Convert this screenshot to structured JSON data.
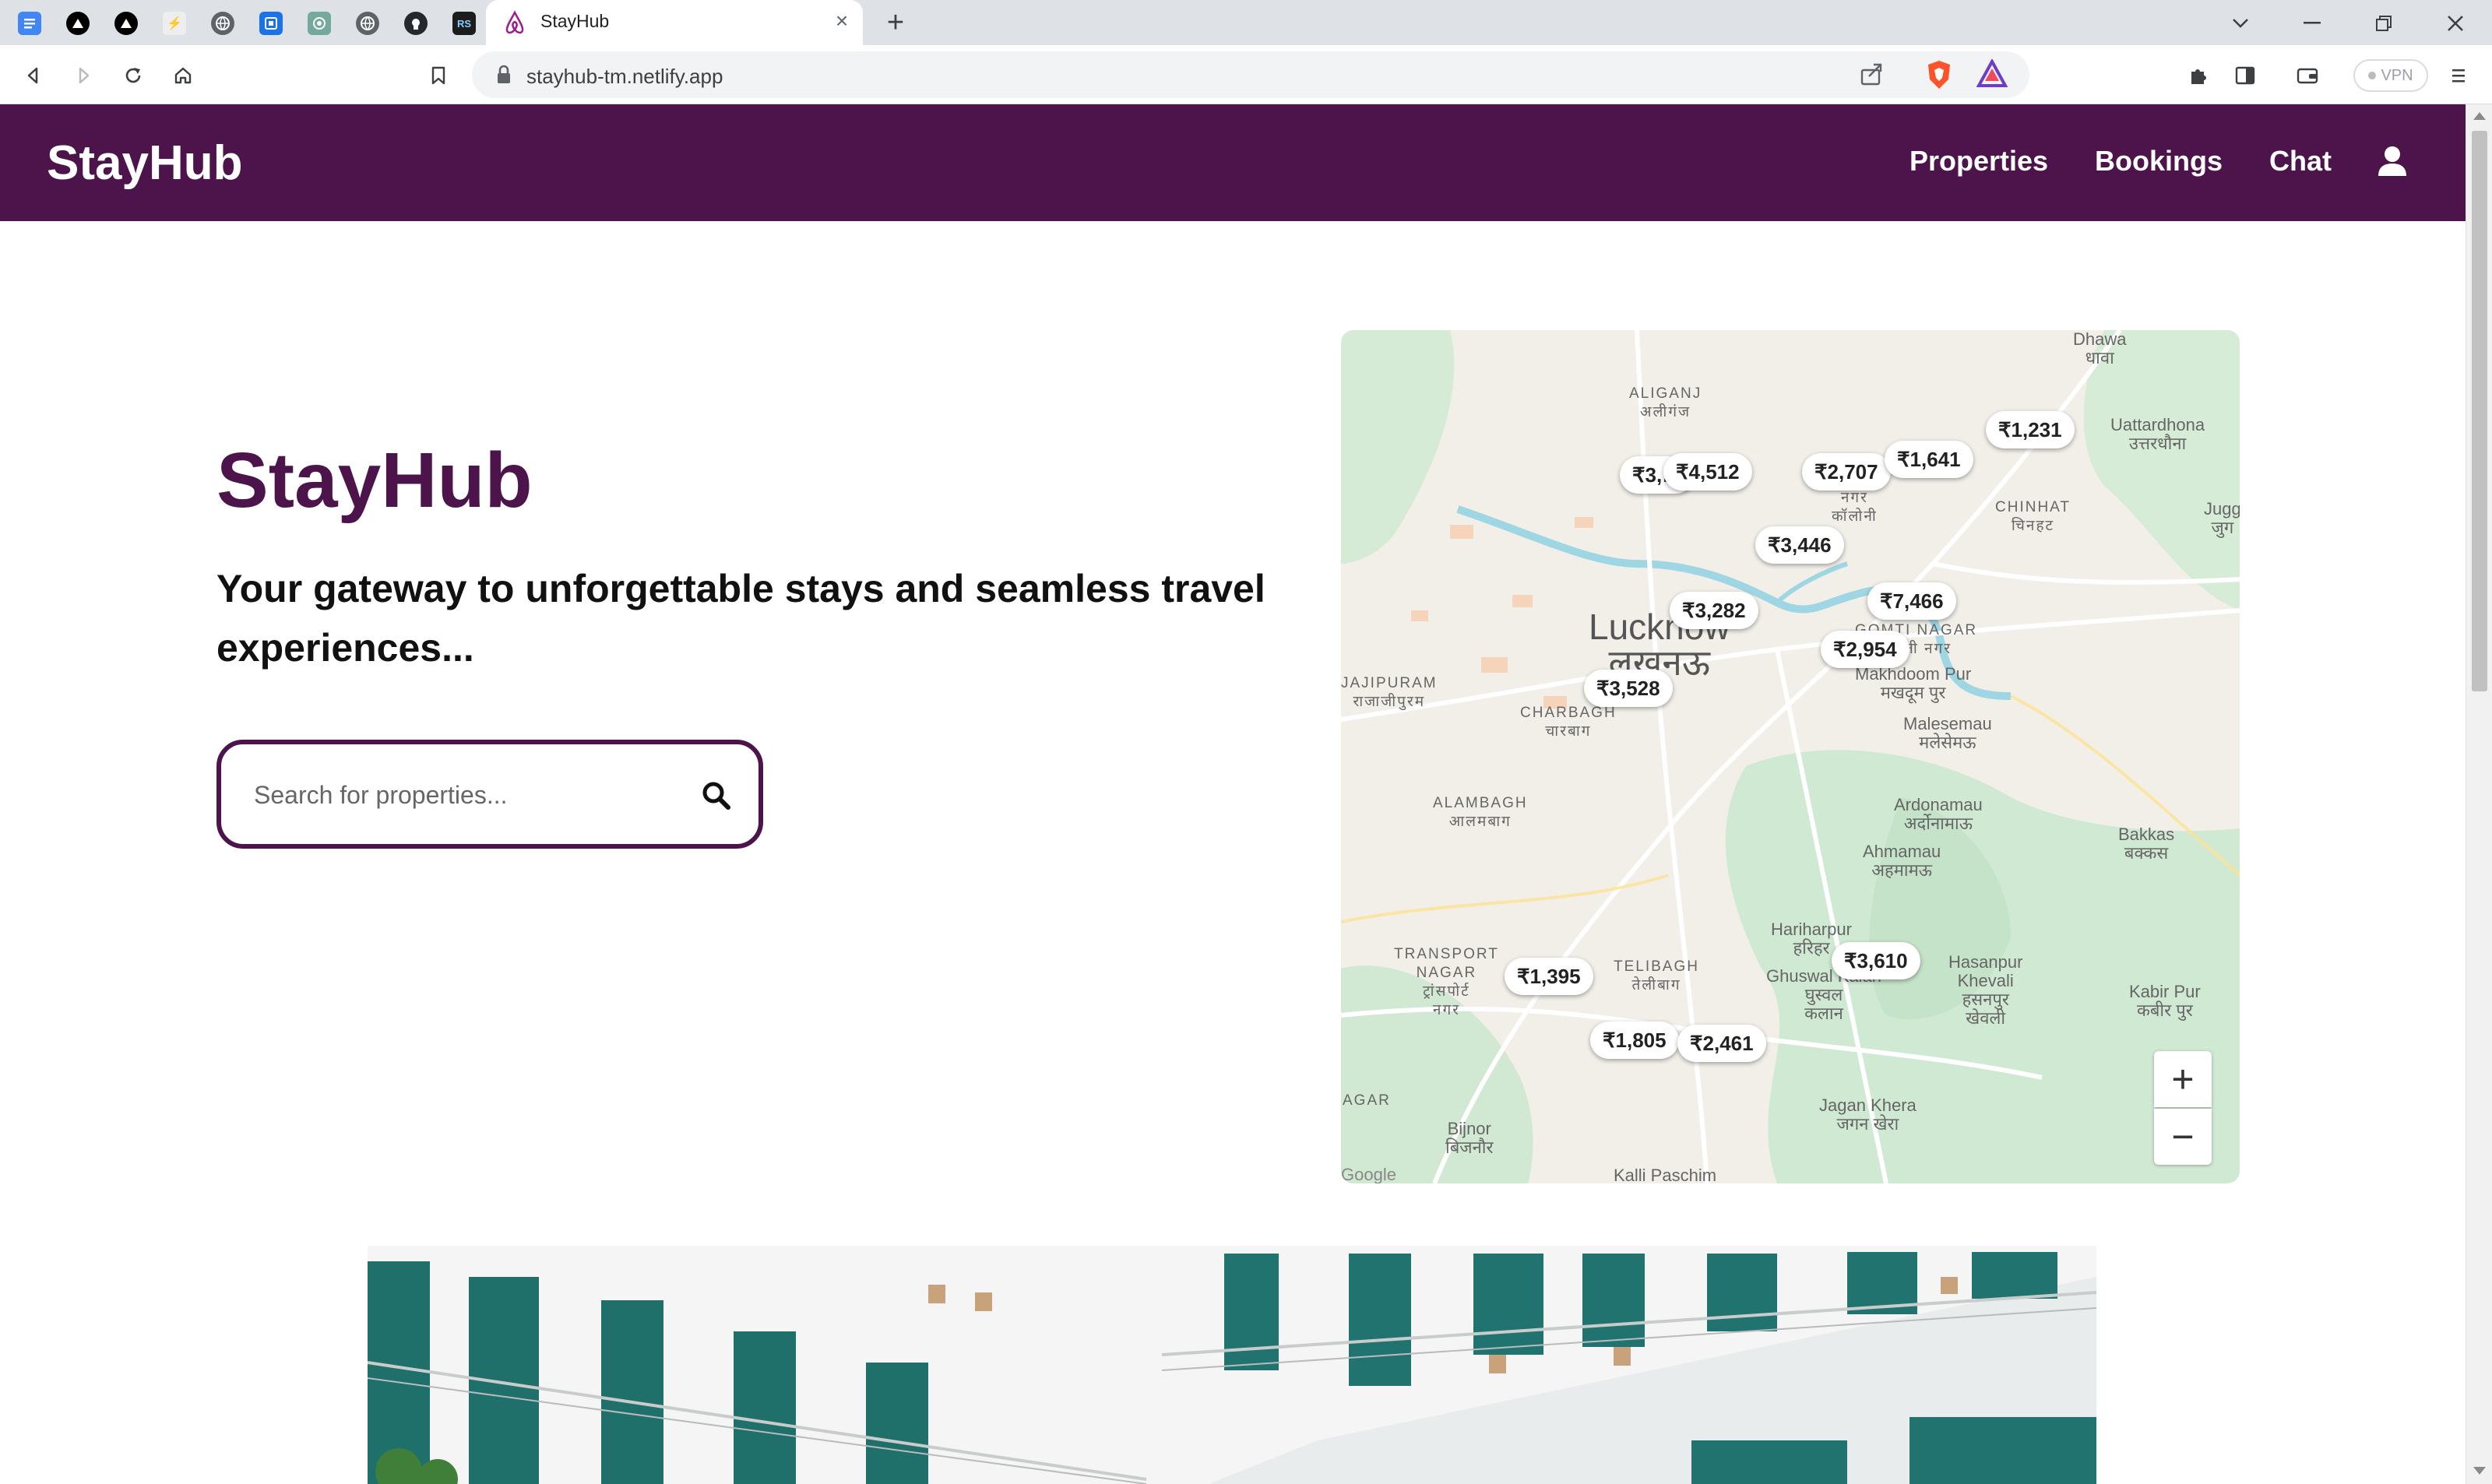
{
  "browser": {
    "pinned_tabs": [
      "docs-icon",
      "vercel-icon",
      "vercel-icon",
      "bolt-icon",
      "globe-icon",
      "app-icon",
      "chatgpt-icon",
      "globe-icon",
      "github-icon",
      "rs-icon"
    ],
    "pinned_rs_label": "RS",
    "active_tab_title": "StayHub",
    "url": "stayhub-tm.netlify.app",
    "vpn_label": "VPN"
  },
  "header": {
    "brand": "StayHub",
    "nav": [
      "Properties",
      "Bookings",
      "Chat"
    ],
    "bg_color": "#4d144b"
  },
  "hero": {
    "title": "StayHub",
    "tagline": "Your gateway to unforgettable stays and seamless travel experiences...",
    "search_placeholder": "Search for properties..."
  },
  "map": {
    "prices": [
      "₹3,…",
      "₹4,512",
      "₹2,707",
      "₹1,641",
      "₹1,231",
      "₹3,446",
      "₹3,282",
      "₹7,466",
      "₹2,954",
      "₹3,528",
      "₹1,395",
      "₹3,610",
      "₹1,805",
      "₹2,461"
    ],
    "labels": {
      "aliganj": "ALIGANJ",
      "aliganj_hi": "अलीगंज",
      "dhawa": "Dhawa",
      "dhawa_hi": "धावा",
      "uattardhona": "Uattardhona",
      "uattardhona_hi": "उत्तरधौना",
      "chinhat": "CHINHAT",
      "chinhat_hi": "चिनहट",
      "jugg": "Jugg",
      "jugg_hi": "जुग",
      "lucknow": "Lucknow",
      "lucknow_hi": "लखनऊ",
      "gomti": "GOMTI NAGAR",
      "gomti_hi": "गोमती नगर",
      "jajipuram": "JAJIPURAM",
      "jajipuram_hi": "राजाजीपुरम",
      "charbagh": "CHARBAGH",
      "charbagh_hi": "चारबाग",
      "makhdoom": "Makhdoom Pur",
      "makhdoom_hi": "मखदूम पुर",
      "malesemau": "Malesemau",
      "malesemau_hi": "मलेसेमऊ",
      "alambagh": "ALAMBAGH",
      "alambagh_hi": "आलमबाग",
      "ardonamau": "Ardonamau",
      "ardonamau_hi": "अर्दोनामाऊ",
      "ahmamau": "Ahmamau",
      "ahmamau_hi": "अहमामऊ",
      "bakkas": "Bakkas",
      "bakkas_hi": "बक्कस",
      "transport": "TRANSPORT",
      "transport2": "NAGAR",
      "transport_hi": "ट्रांसपोर्ट",
      "transport_hi2": "नगर",
      "telibagh": "TELIBAGH",
      "telibagh_hi": "तेलीबाग",
      "hariharpur": "Hariharpur",
      "hariharpur_hi": "हरिहर",
      "ghuswal": "Ghuswal Kalan",
      "ghuswal_hi": "घुस्वल",
      "ghuswal_hi2": "कलान",
      "hasanpur": "Hasanpur",
      "hasanpur2": "Khevali",
      "hasanpur_hi": "हसनपुर",
      "hasanpur_hi2": "खेवली",
      "kabir": "Kabir Pur",
      "kabir_hi": "कबीर पुर",
      "agar": "AGAR",
      "bijnor": "Bijnor",
      "bijnor_hi": "बिजनौर",
      "jagan": "Jagan Khera",
      "jagan_hi": "जगन खेरा",
      "kalli": "Kalli Paschim",
      "nagar_hi": "नगर",
      "colony_hi": "कॉलोनी"
    },
    "zoom_in": "+",
    "zoom_out": "−",
    "attribution": "Google"
  }
}
